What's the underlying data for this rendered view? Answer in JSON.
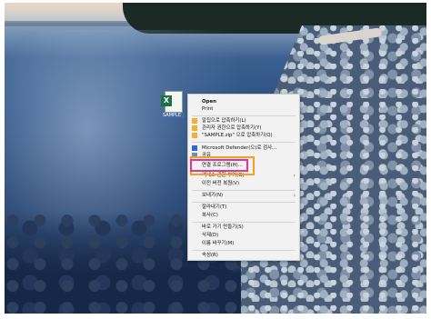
{
  "desktop": {
    "file": {
      "icon": "excel-file-icon",
      "label": "SAMPLE"
    }
  },
  "context_menu": {
    "items": [
      {
        "label": "Open",
        "bold": true
      },
      {
        "label": "Print"
      },
      {
        "label": "알집으로 압축하기(L)",
        "icon": "alzip-icon"
      },
      {
        "label": "관리자 권한으로 압축하기(Y)",
        "icon": "alzip-admin-icon"
      },
      {
        "label": "\"SAMPLE.zip\" 으로 압축하기(Q)",
        "icon": "alzip-zip-icon"
      },
      {
        "label": "Microsoft Defender(으)로 검사...",
        "icon": "defender-icon"
      },
      {
        "label": "공유",
        "icon": "share-icon"
      },
      {
        "label": "연결 프로그램(H)..."
      },
      {
        "label": "액세스 권한 부여(G)",
        "submenu": true
      },
      {
        "label": "이전 버전 복원(V)"
      },
      {
        "label": "보내기(N)",
        "submenu": true
      },
      {
        "label": "잘라내기(T)"
      },
      {
        "label": "복사(C)"
      },
      {
        "label": "바로 가기 만들기(S)"
      },
      {
        "label": "삭제(D)"
      },
      {
        "label": "이름 바꾸기(M)"
      },
      {
        "label": "속성(R)"
      }
    ]
  },
  "colors": {
    "highlight_pink": "#e6358f",
    "highlight_orange": "#f5a020"
  }
}
